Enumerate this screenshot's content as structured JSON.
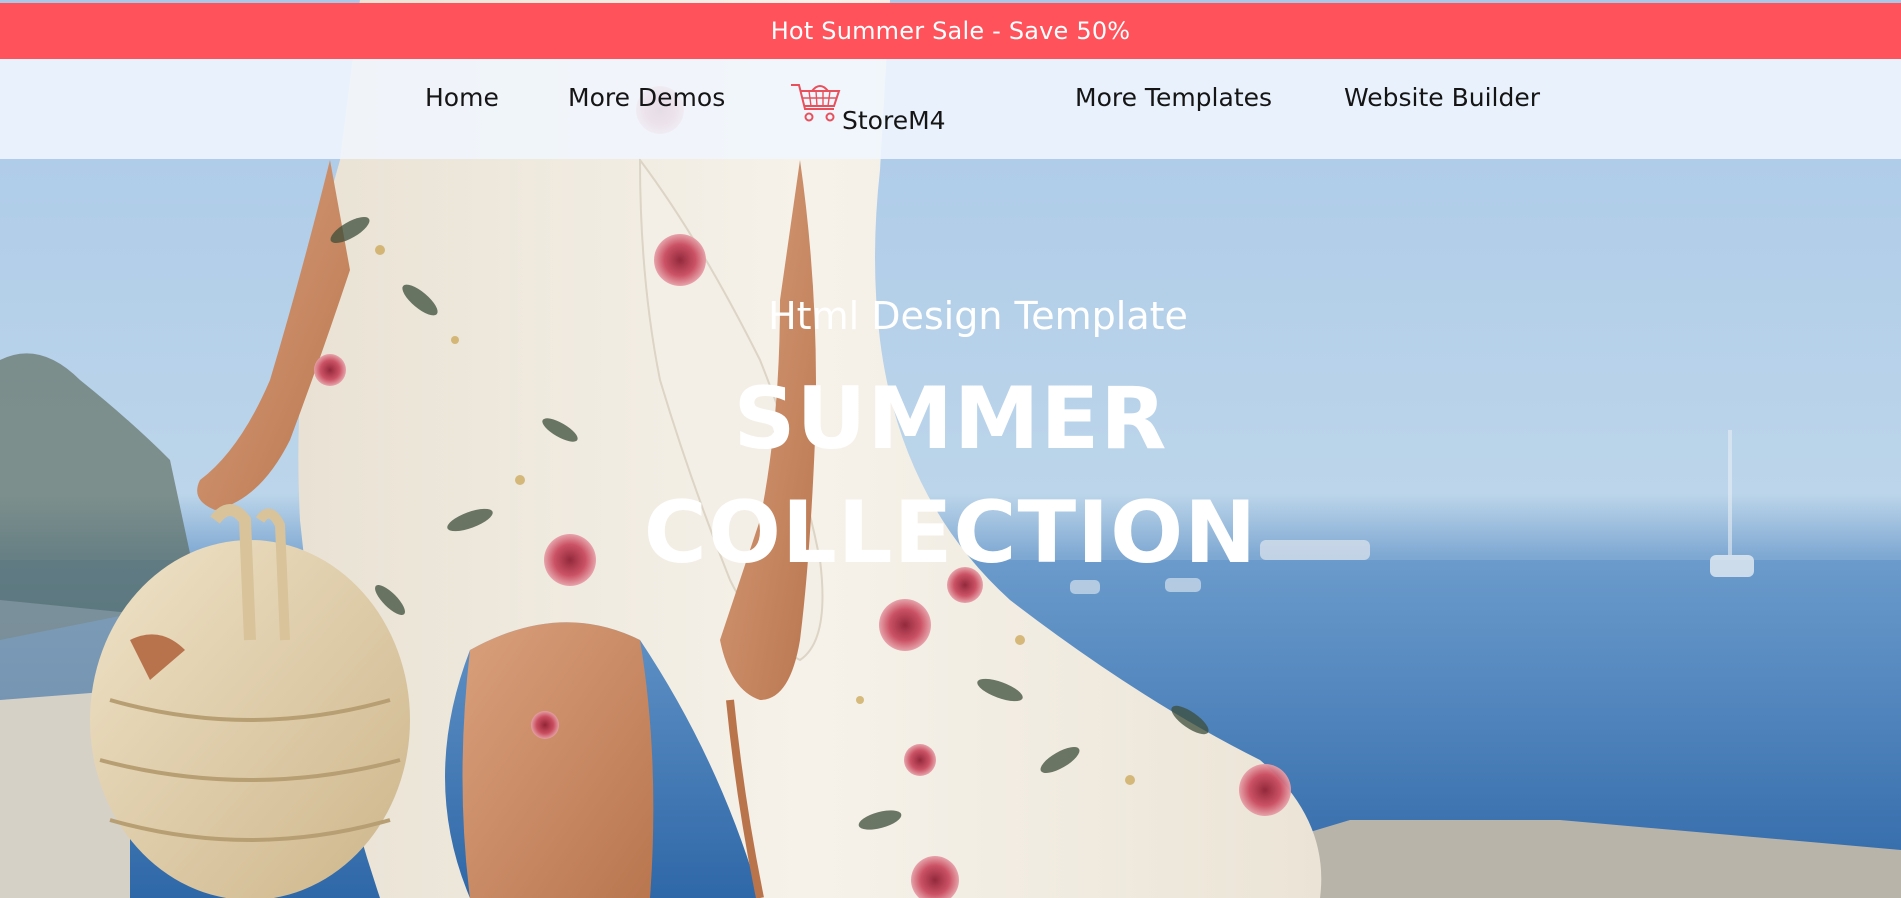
{
  "promo": {
    "text": "Hot Summer Sale - Save 50%"
  },
  "nav": {
    "items": [
      {
        "label": "Home"
      },
      {
        "label": "More Demos"
      },
      {
        "label": "More Templates"
      },
      {
        "label": "Website Builder"
      }
    ],
    "brand": {
      "name": "StoreM4",
      "icon": "shopping-cart-icon"
    }
  },
  "hero": {
    "subtitle": "Html Design Template",
    "title_line1": "SUMMER",
    "title_line2": "COLLECTION"
  },
  "colors": {
    "promo_bg": "#ff525b",
    "nav_bg": "#f0f6fe",
    "accent": "#e8505b",
    "hero_text": "#ffffff"
  }
}
